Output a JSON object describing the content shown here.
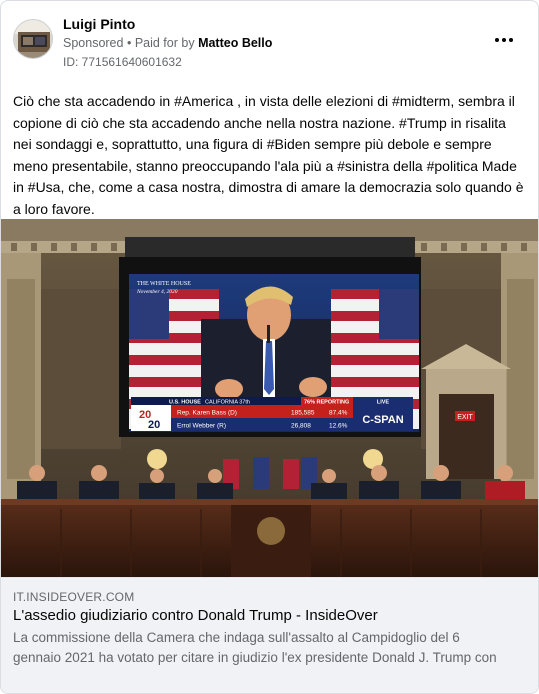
{
  "post": {
    "author": "Luigi Pinto",
    "sponsored": "Sponsored",
    "paid_for_prefix": "Paid for by",
    "paid_for_name": "Matteo Bello",
    "id_text": "ID: 771561640601632",
    "more_icon": "more-horizontal-icon",
    "text_lines": [
      "Ciò che sta accadendo in #America , in vista delle elezioni di #midterm, sembra il",
      "copione di ciò che sta accadendo anche nella nostra nazione. #Trump in risalita",
      "nei sondaggi e, soprattutto, una figura di #Biden sempre più debole e sempre",
      "meno presentabile, stanno preoccupando l'ala più a #sinistra della #politica Made",
      "in #Usa, che, come a casa nostra, dimostra di amare la democrazia solo quando è",
      "a loro favore."
    ]
  },
  "image": {
    "screen_header": "THE WHITE HOUSE",
    "screen_date": "November 4, 2020",
    "tv_state": "U.S. HOUSE",
    "tv_district": "CALIFORNIA 37th",
    "tv_reporting": "76% REPORTING",
    "tv_live": "LIVE",
    "tv_logo_year_a": "20",
    "tv_logo_year_b": "20",
    "tv_network": "C-SPAN",
    "candidates": [
      {
        "name": "Rep. Karen Bass (D)",
        "votes": "185,585",
        "pct": "87.4%"
      },
      {
        "name": "Errol Webber (R)",
        "votes": "26,808",
        "pct": "12.6%"
      }
    ],
    "exit_sign": "EXIT"
  },
  "link": {
    "domain": "IT.INSIDEOVER.COM",
    "title": "L'assedio giudiziario contro Donald Trump - InsideOver",
    "desc_lines": [
      "La commissione della Camera che indaga sull'assalto al Campidoglio del 6",
      "gennaio 2021 ha votato per citare in giudizio l'ex presidente Donald J. Trump con"
    ]
  }
}
